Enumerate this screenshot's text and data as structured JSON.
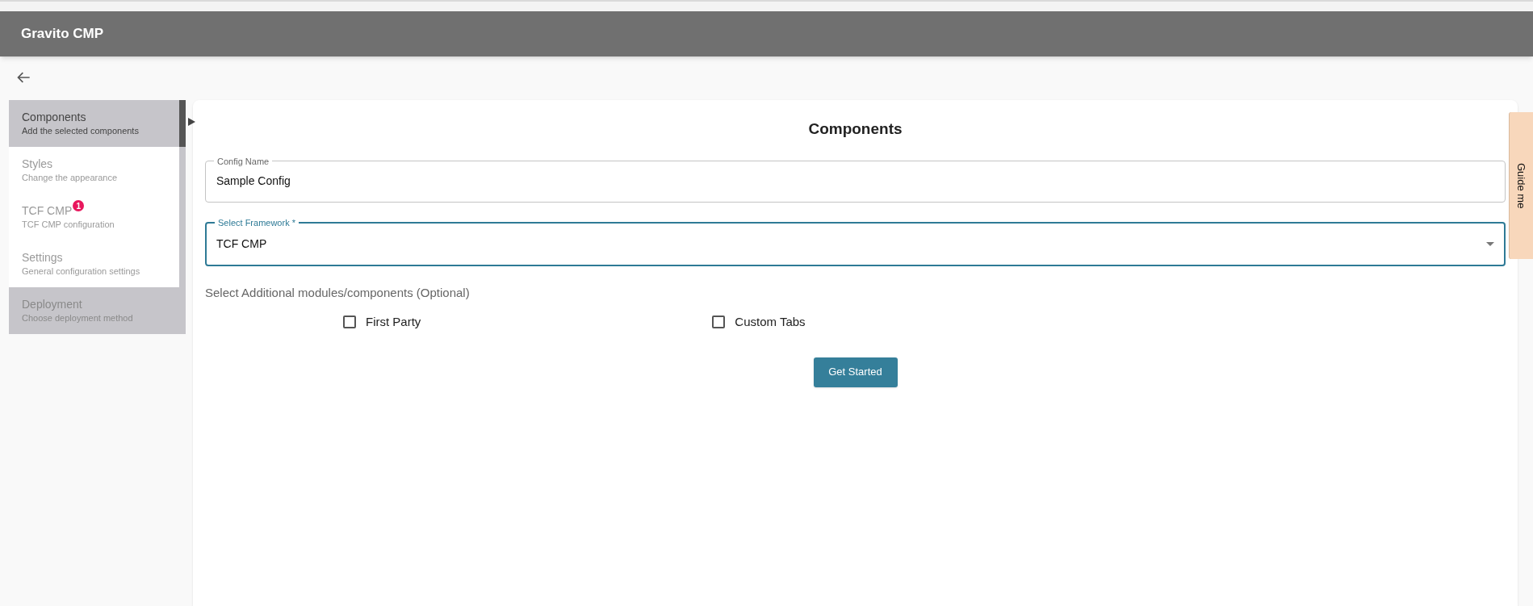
{
  "header": {
    "title": "Gravito CMP"
  },
  "sidebar": {
    "items": [
      {
        "title": "Components",
        "subtitle": "Add the selected components",
        "selected": true
      },
      {
        "title": "Styles",
        "subtitle": "Change the appearance",
        "selected": false
      },
      {
        "title": "TCF CMP",
        "subtitle": "TCF CMP configuration",
        "selected": false,
        "badge": "1"
      },
      {
        "title": "Settings",
        "subtitle": "General configuration settings",
        "selected": false
      }
    ],
    "footer_item": {
      "title": "Deployment",
      "subtitle": "Choose deployment method"
    }
  },
  "main": {
    "title": "Components",
    "config_name": {
      "label": "Config Name",
      "value": "Sample Config"
    },
    "framework": {
      "label": "Select Framework *",
      "value": "TCF CMP"
    },
    "modules_label": "Select Additional modules/components (Optional)",
    "modules": [
      {
        "label": "First Party",
        "checked": false
      },
      {
        "label": "Custom Tabs",
        "checked": false
      }
    ],
    "button": "Get Started"
  },
  "guide_tab": "Guide me"
}
